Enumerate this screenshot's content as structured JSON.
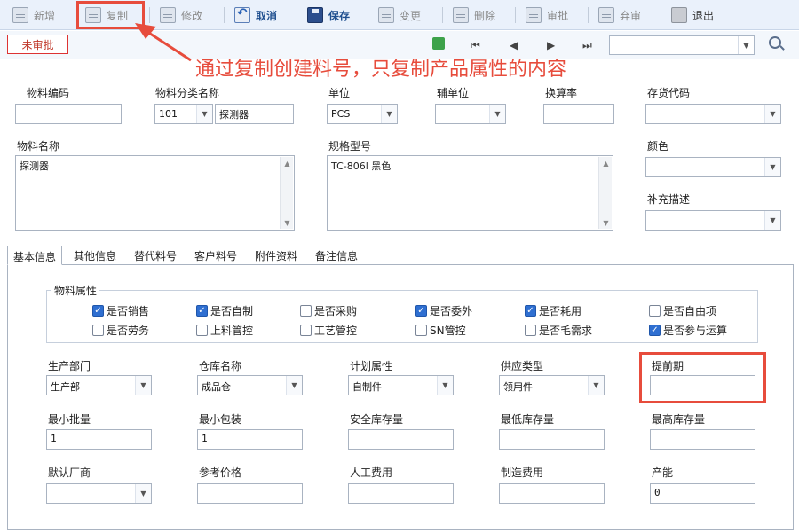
{
  "toolbar": {
    "new": "新增",
    "copy": "复制",
    "edit": "修改",
    "cancel": "取消",
    "save": "保存",
    "change": "变更",
    "delete": "删除",
    "approve": "审批",
    "unapprove": "弃审",
    "exit": "退出"
  },
  "status_label": "未审批",
  "nav": {
    "first": "⏮",
    "prev": "◀",
    "next": "▶",
    "last": "⏭"
  },
  "annotation": "通过复制创建料号，只复制产品属性的内容",
  "header": {
    "material_code": {
      "label": "物料编码",
      "value": ""
    },
    "category": {
      "label": "物料分类名称",
      "code": "101",
      "name": "探测器"
    },
    "unit": {
      "label": "单位",
      "value": "PCS"
    },
    "aux_unit": {
      "label": "辅单位",
      "value": ""
    },
    "conversion": {
      "label": "换算率",
      "value": ""
    },
    "inventory_code": {
      "label": "存货代码",
      "value": ""
    },
    "material_name": {
      "label": "物料名称",
      "value": "探测器"
    },
    "spec": {
      "label": "规格型号",
      "value": "TC-806l 黑色"
    },
    "color": {
      "label": "颜色",
      "value": ""
    },
    "supplement": {
      "label": "补充描述",
      "value": ""
    }
  },
  "tabs": [
    "基本信息",
    "其他信息",
    "替代料号",
    "客户料号",
    "附件资料",
    "备注信息"
  ],
  "attributes": {
    "title": "物料属性",
    "items": [
      {
        "label": "是否销售",
        "checked": true
      },
      {
        "label": "是否自制",
        "checked": true
      },
      {
        "label": "是否采购",
        "checked": false
      },
      {
        "label": "是否委外",
        "checked": true
      },
      {
        "label": "是否耗用",
        "checked": true
      },
      {
        "label": "是否自由项",
        "checked": false
      },
      {
        "label": "是否劳务",
        "checked": false
      },
      {
        "label": "上料管控",
        "checked": false
      },
      {
        "label": "工艺管控",
        "checked": false
      },
      {
        "label": "SN管控",
        "checked": false
      },
      {
        "label": "是否毛需求",
        "checked": false
      },
      {
        "label": "是否参与运算",
        "checked": true
      }
    ]
  },
  "fields": {
    "prod_dept": {
      "label": "生产部门",
      "value": "生产部"
    },
    "warehouse": {
      "label": "仓库名称",
      "value": "成品仓"
    },
    "plan_attr": {
      "label": "计划属性",
      "value": "自制件"
    },
    "supply_type": {
      "label": "供应类型",
      "value": "领用件"
    },
    "lead_time": {
      "label": "提前期",
      "value": ""
    },
    "min_batch": {
      "label": "最小批量",
      "value": "1"
    },
    "min_pack": {
      "label": "最小包装",
      "value": "1"
    },
    "safety_stock": {
      "label": "安全库存量",
      "value": ""
    },
    "min_stock": {
      "label": "最低库存量",
      "value": ""
    },
    "max_stock": {
      "label": "最高库存量",
      "value": ""
    },
    "default_vendor": {
      "label": "默认厂商",
      "value": ""
    },
    "ref_price": {
      "label": "参考价格",
      "value": ""
    },
    "labor_cost": {
      "label": "人工费用",
      "value": ""
    },
    "mfg_cost": {
      "label": "制造费用",
      "value": ""
    },
    "capacity": {
      "label": "产能",
      "value": "0"
    }
  },
  "colors": {
    "accent": "#2f6fd1",
    "highlight": "#e74c3c",
    "toolbar_bg": "#eaf1fb"
  }
}
